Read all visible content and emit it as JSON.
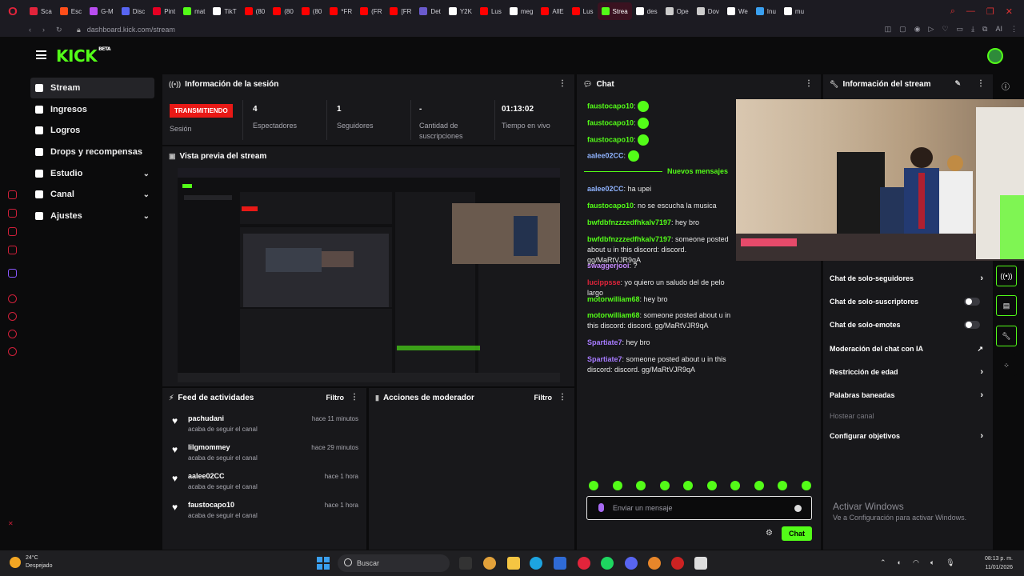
{
  "browser": {
    "tabs": [
      {
        "label": "Sca",
        "color": "#e2243b"
      },
      {
        "label": "Esc",
        "color": "#ff4e1a"
      },
      {
        "label": "G-M",
        "color": "#b94df0"
      },
      {
        "label": "Disc",
        "color": "#5865f2"
      },
      {
        "label": "Pint",
        "color": "#e60023"
      },
      {
        "label": "mat",
        "color": "#53fc18"
      },
      {
        "label": "TikT",
        "color": "#ffffff"
      },
      {
        "label": "(80",
        "color": "#ff0000"
      },
      {
        "label": "(80",
        "color": "#ff0000"
      },
      {
        "label": "(80",
        "color": "#ff0000"
      },
      {
        "label": "*FR",
        "color": "#ff0000"
      },
      {
        "label": "(FR",
        "color": "#ff0000"
      },
      {
        "label": "[FR",
        "color": "#ff0000"
      },
      {
        "label": "Det",
        "color": "#6a5acd"
      },
      {
        "label": "Y2K",
        "color": "#ffffff"
      },
      {
        "label": "Lus",
        "color": "#ff0000"
      },
      {
        "label": "meg",
        "color": "#ffffff"
      },
      {
        "label": "AllE",
        "color": "#ff0000"
      },
      {
        "label": "Lus",
        "color": "#ff0000"
      },
      {
        "label": "Strea",
        "color": "#53fc18"
      },
      {
        "label": "des",
        "color": "#ffffff"
      },
      {
        "label": "Ope",
        "color": "#cccccc"
      },
      {
        "label": "Dov",
        "color": "#cccccc"
      },
      {
        "label": "We",
        "color": "#ffffff"
      },
      {
        "label": "Inu",
        "color": "#3aa0f0"
      },
      {
        "label": "mu",
        "color": "#ffffff"
      }
    ],
    "active_tab_index": 19,
    "url": "dashboard.kick.com/stream"
  },
  "header": {
    "logo": "KICK",
    "logo_beta": "BETA"
  },
  "nav": {
    "items": [
      {
        "label": "Stream",
        "active": true,
        "chevron": false
      },
      {
        "label": "Ingresos",
        "active": false,
        "chevron": false
      },
      {
        "label": "Logros",
        "active": false,
        "chevron": false
      },
      {
        "label": "Drops y recompensas",
        "active": false,
        "chevron": false
      },
      {
        "label": "Estudio",
        "active": false,
        "chevron": true
      },
      {
        "label": "Canal",
        "active": false,
        "chevron": true
      },
      {
        "label": "Ajustes",
        "active": false,
        "chevron": true
      }
    ]
  },
  "session": {
    "title": "Información de la sesión",
    "badge": "TRANSMITIENDO",
    "session_label": "Sesión",
    "stats": [
      {
        "value": "4",
        "label": "Espectadores"
      },
      {
        "value": "1",
        "label": "Seguidores"
      },
      {
        "value": "-",
        "label": "Cantidad de suscripciones"
      },
      {
        "value": "01:13:02",
        "label": "Tiempo en vivo"
      }
    ]
  },
  "preview": {
    "title": "Vista previa del stream"
  },
  "activity": {
    "title": "Feed de actividades",
    "filter": "Filtro",
    "items": [
      {
        "name": "pachudani",
        "action": "acaba de seguir el canal",
        "time": "hace 11 minutos"
      },
      {
        "name": "lilgmommey",
        "action": "acaba de seguir el canal",
        "time": "hace 29 minutos"
      },
      {
        "name": "aalee02CC",
        "action": "acaba de seguir el canal",
        "time": "hace 1 hora"
      },
      {
        "name": "faustocapo10",
        "action": "acaba de seguir el canal",
        "time": "hace 1 hora"
      }
    ]
  },
  "moderator": {
    "title": "Acciones de moderador",
    "filter": "Filtro"
  },
  "chat": {
    "title": "Chat",
    "new_messages": "Nuevos mensajes",
    "messages": [
      {
        "user": "faustocapo10",
        "color": "#53fc18",
        "text": "",
        "emote": true
      },
      {
        "user": "faustocapo10",
        "color": "#53fc18",
        "text": "",
        "emote": true
      },
      {
        "user": "faustocapo10",
        "color": "#53fc18",
        "text": "",
        "emote": true
      },
      {
        "user": "aalee02CC",
        "color": "#8fb3ff",
        "text": "",
        "emote": true
      },
      {
        "user": "aalee02CC",
        "color": "#8fb3ff",
        "text": "ha upei",
        "emote": false
      },
      {
        "user": "faustocapo10",
        "color": "#53fc18",
        "text": "no se escucha la musica",
        "emote": false
      },
      {
        "user": "bwfdbfnzzzedfhkalv7197",
        "color": "#53fc18",
        "text": "hey bro",
        "emote": false
      },
      {
        "user": "bwfdbfnzzzedfhkalv7197",
        "color": "#53fc18",
        "text": "someone posted about u in this discord: discord. gg/MaRtVJR9qA",
        "emote": false
      },
      {
        "user": "swaggerjooi",
        "color": "#c88bff",
        "text": "?",
        "emote": false
      },
      {
        "user": "lucippsse",
        "color": "#e2243b",
        "text": "yo quiero un saludo del de pelo largo",
        "emote": false
      },
      {
        "user": "motorwilliam68",
        "color": "#53fc18",
        "text": "hey bro",
        "emote": false
      },
      {
        "user": "motorwilliam68",
        "color": "#53fc18",
        "text": "someone posted about u in this discord: discord. gg/MaRtVJR9qA",
        "emote": false
      },
      {
        "user": "Spartiate7",
        "color": "#a77bff",
        "text": "hey bro",
        "emote": false
      },
      {
        "user": "Spartiate7",
        "color": "#a77bff",
        "text": "someone posted about u in this discord: discord. gg/MaRtVJR9qA",
        "emote": false
      }
    ],
    "input_placeholder": "Enviar un mensaje",
    "send_label": "Chat"
  },
  "stream_info": {
    "title": "Información del stream",
    "controls": [
      {
        "label": "Chat de solo-seguidores",
        "kind": "arrow"
      },
      {
        "label": "Chat de solo-suscriptores",
        "kind": "toggle"
      },
      {
        "label": "Chat de solo-emotes",
        "kind": "toggle"
      },
      {
        "label": "Moderación del chat con IA",
        "kind": "external"
      },
      {
        "label": "Restricción de edad",
        "kind": "arrow"
      },
      {
        "label": "Palabras baneadas",
        "kind": "arrow"
      },
      {
        "label": "Hostear canal",
        "kind": "disabled"
      },
      {
        "label": "Configurar objetivos",
        "kind": "arrow"
      }
    ]
  },
  "windows": {
    "activate_title": "Activar Windows",
    "activate_sub": "Ve a Configuración para activar Windows."
  },
  "taskbar": {
    "temp": "24°C",
    "weather": "Despejado",
    "search_placeholder": "Buscar",
    "time": "08:13 p. m.",
    "date": "11/01/2026"
  }
}
